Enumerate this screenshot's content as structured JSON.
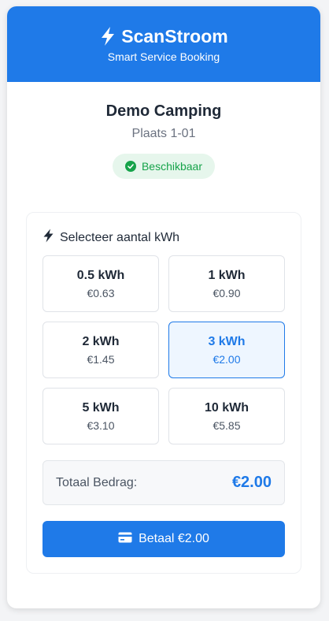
{
  "header": {
    "brand": "ScanStroom",
    "subtitle": "Smart Service Booking",
    "icon": "bolt-icon"
  },
  "site": {
    "name": "Demo Camping",
    "place": "Plaats 1-01",
    "status": "Beschikbaar",
    "status_color": "#16a34a"
  },
  "selector": {
    "title": "Selecteer aantal kWh",
    "options": [
      {
        "kwh": "0.5 kWh",
        "price": "€0.63"
      },
      {
        "kwh": "1 kWh",
        "price": "€0.90"
      },
      {
        "kwh": "2 kWh",
        "price": "€1.45"
      },
      {
        "kwh": "3 kWh",
        "price": "€2.00"
      },
      {
        "kwh": "5 kWh",
        "price": "€3.10"
      },
      {
        "kwh": "10 kWh",
        "price": "€5.85"
      }
    ],
    "selected_index": 3
  },
  "total": {
    "label": "Totaal Bedrag:",
    "value": "€2.00"
  },
  "pay_button": {
    "label": "Betaal €2.00",
    "icon": "credit-card-icon"
  },
  "colors": {
    "accent": "#1f7ae8",
    "success": "#16a34a"
  }
}
